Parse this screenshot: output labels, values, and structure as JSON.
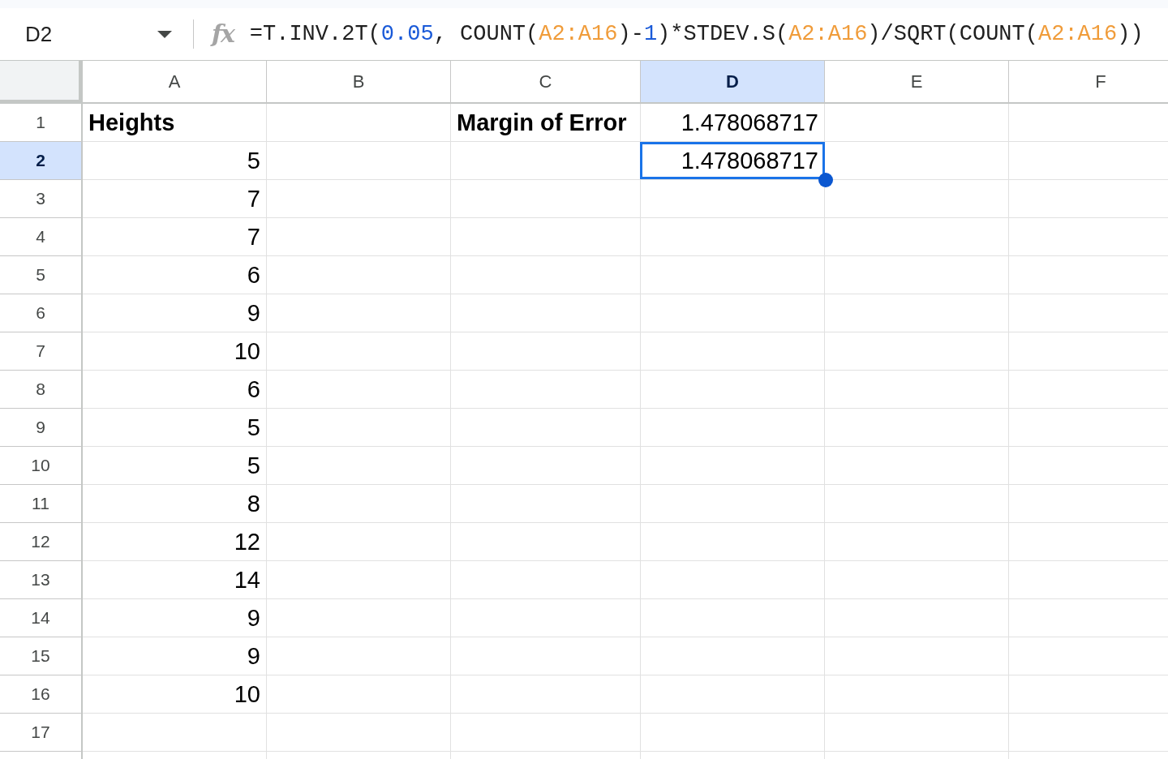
{
  "name_box": {
    "value": "D2"
  },
  "formula_bar": {
    "icon": "fx",
    "segments": [
      {
        "kind": "plain",
        "text": "=T.INV.2T("
      },
      {
        "kind": "number",
        "text": "0.05"
      },
      {
        "kind": "plain",
        "text": ", COUNT("
      },
      {
        "kind": "range",
        "text": "A2:A16"
      },
      {
        "kind": "plain",
        "text": ")-"
      },
      {
        "kind": "number",
        "text": "1"
      },
      {
        "kind": "plain",
        "text": ")*STDEV.S("
      },
      {
        "kind": "range",
        "text": "A2:A16"
      },
      {
        "kind": "plain",
        "text": ")/SQRT(COUNT("
      },
      {
        "kind": "range",
        "text": "A2:A16"
      },
      {
        "kind": "plain",
        "text": "))"
      }
    ]
  },
  "columns": [
    {
      "label": "A",
      "selected": false
    },
    {
      "label": "B",
      "selected": false
    },
    {
      "label": "C",
      "selected": false
    },
    {
      "label": "D",
      "selected": true
    },
    {
      "label": "E",
      "selected": false
    },
    {
      "label": "F",
      "selected": false
    }
  ],
  "rows": [
    {
      "label": "1",
      "selected": false,
      "cells": {
        "A": {
          "value": "Heights",
          "kind": "heading"
        },
        "C": {
          "value": "Margin of Error",
          "kind": "heading"
        },
        "D": {
          "value": "1.478068717",
          "kind": "number"
        }
      }
    },
    {
      "label": "2",
      "selected": true,
      "cells": {
        "A": {
          "value": "5",
          "kind": "number"
        },
        "D": {
          "value": "1.478068717",
          "kind": "number"
        }
      }
    },
    {
      "label": "3",
      "selected": false,
      "cells": {
        "A": {
          "value": "7",
          "kind": "number"
        }
      }
    },
    {
      "label": "4",
      "selected": false,
      "cells": {
        "A": {
          "value": "7",
          "kind": "number"
        }
      }
    },
    {
      "label": "5",
      "selected": false,
      "cells": {
        "A": {
          "value": "6",
          "kind": "number"
        }
      }
    },
    {
      "label": "6",
      "selected": false,
      "cells": {
        "A": {
          "value": "9",
          "kind": "number"
        }
      }
    },
    {
      "label": "7",
      "selected": false,
      "cells": {
        "A": {
          "value": "10",
          "kind": "number"
        }
      }
    },
    {
      "label": "8",
      "selected": false,
      "cells": {
        "A": {
          "value": "6",
          "kind": "number"
        }
      }
    },
    {
      "label": "9",
      "selected": false,
      "cells": {
        "A": {
          "value": "5",
          "kind": "number"
        }
      }
    },
    {
      "label": "10",
      "selected": false,
      "cells": {
        "A": {
          "value": "5",
          "kind": "number"
        }
      }
    },
    {
      "label": "11",
      "selected": false,
      "cells": {
        "A": {
          "value": "8",
          "kind": "number"
        }
      }
    },
    {
      "label": "12",
      "selected": false,
      "cells": {
        "A": {
          "value": "12",
          "kind": "number"
        }
      }
    },
    {
      "label": "13",
      "selected": false,
      "cells": {
        "A": {
          "value": "14",
          "kind": "number"
        }
      }
    },
    {
      "label": "14",
      "selected": false,
      "cells": {
        "A": {
          "value": "9",
          "kind": "number"
        }
      }
    },
    {
      "label": "15",
      "selected": false,
      "cells": {
        "A": {
          "value": "9",
          "kind": "number"
        }
      }
    },
    {
      "label": "16",
      "selected": false,
      "cells": {
        "A": {
          "value": "10",
          "kind": "number"
        }
      }
    },
    {
      "label": "17",
      "selected": false
    }
  ]
}
